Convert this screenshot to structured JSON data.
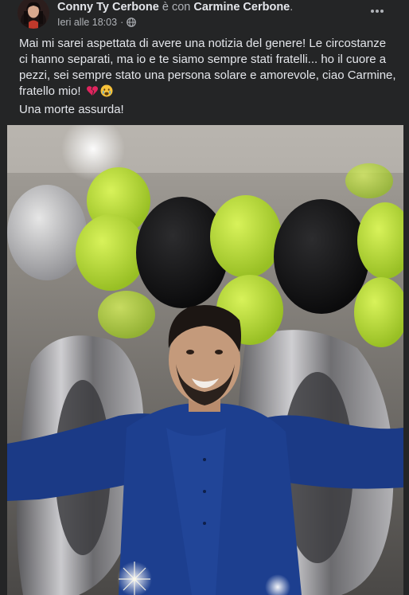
{
  "post": {
    "author": "Conny Ty Cerbone",
    "with_connector": "è con",
    "tagged": "Carmine Cerbone",
    "tagged_suffix": ".",
    "timestamp": "Ieri alle 18:03",
    "separator": "·",
    "text_lines": [
      "Mai mi sarei aspettata di avere una notizia del genere! Le circostanze ci hanno separati, ma io e te siamo sempre stati fratelli... ho il cuore a pezzi, sei sempre stato una persona solare e amorevole, ciao Carmine, fratello mio!",
      "Una morte assurda!"
    ],
    "icons": {
      "privacy": "globe-icon",
      "menu": "more-options-icon",
      "emojis": [
        "broken-heart-emoji",
        "crying-face-emoji"
      ]
    }
  },
  "colors": {
    "background": "#18191a",
    "card": "#242526",
    "text_primary": "#e4e6eb",
    "text_secondary": "#b0b3b8",
    "balloon_green": "#b5d93a",
    "shirt_blue": "#1d3f8f"
  }
}
